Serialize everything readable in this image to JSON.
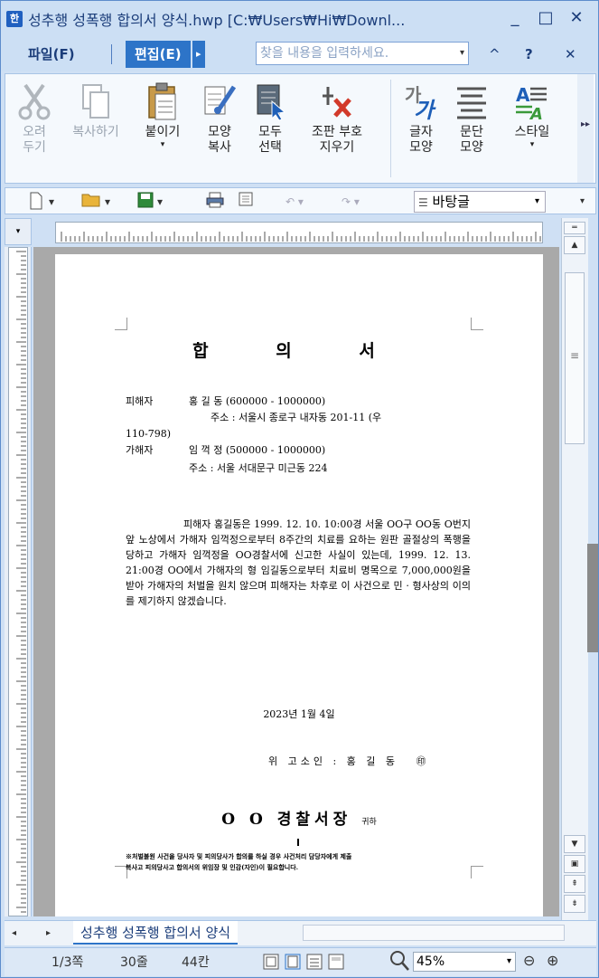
{
  "window": {
    "title": "성추행 성폭행 합의서 양식.hwp [C:₩Users₩Hi₩Downl...",
    "minimize": "_",
    "maximize": "□",
    "close": "✕"
  },
  "menu": {
    "file": "파일(F)",
    "edit": "편집(E)",
    "search_placeholder": "찾을 내용을 입력하세요.",
    "collapse": "^",
    "help": "?",
    "close": "✕"
  },
  "ribbon": {
    "cut": "오려\n두기",
    "copy": "복사하기",
    "paste": "붙이기",
    "format_copy": "모양\n복사",
    "select_all": "모두\n선택",
    "clear_marks": "조판 부호\n지우기",
    "char_shape": "글자\n모양",
    "para_shape": "문단\n모양",
    "style": "스타일"
  },
  "toolbar": {
    "style_value": "바탕글"
  },
  "document": {
    "title": "합 의 서",
    "victim_label": "피해자",
    "victim_name": "홍 길 동 (600000 - 1000000)",
    "victim_address": "주소 : 서울시 종로구 내자동 201-11 (우",
    "victim_zip": "110-798)",
    "offender_label": "가해자",
    "offender_name": "임 꺽 정 (500000 - 1000000)",
    "offender_address": "주소 : 서울 서대문구 미근동 224",
    "body": "피해자 홍길동은 1999. 12. 10. 10:00경 서울 OO구 OO동 O번지 앞 노상에서 가해자 임꺽정으로부터 8주간의 치료를 요하는 원판 골절상의 폭행을 당하고 가해자 임꺽정을 OO경찰서에 신고한 사실이 있는데, 1999. 12. 13. 21:00경 OO에서 가해자의 형 임길동으로부터 치료비 명목으로 7,000,000원을 받아 가해자의 처벌을 원치 않으며 피해자는 차후로 이 사건으로 민 · 형사상의 이의를 제기하지 않겠습니다.",
    "date": "2023년 1월 4일",
    "signer": "위 고소인 : 홍 길 동",
    "station": "O O 경찰서장",
    "station_suffix": "귀하",
    "footnote_1": "※처벌불원 사건을 당사자 및 피의당사가 합의를 하실 경우 사건처리 담당자에게 제출",
    "footnote_2": "복사고 피의당사고 합의서의 위임장 및 인감(자인)이 필요합니다."
  },
  "tabs": {
    "doc_tab": "성추행 성폭행 합의서 양식"
  },
  "status": {
    "page": "1/3쪽",
    "line": "30줄",
    "column": "44칸",
    "zoom": "45%"
  }
}
